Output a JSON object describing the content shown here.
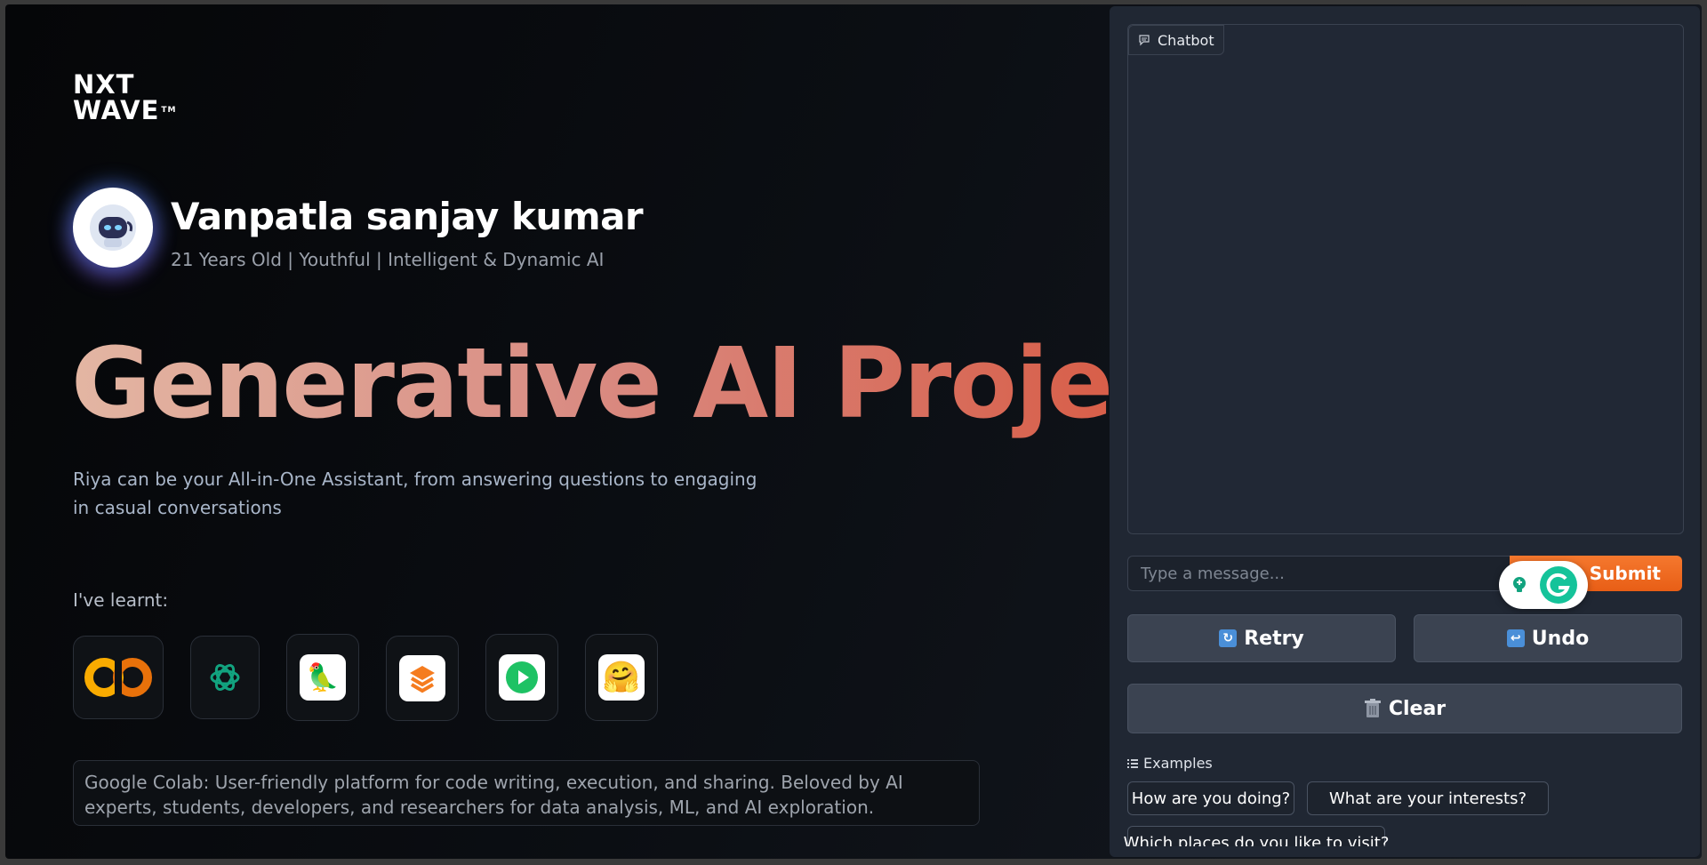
{
  "brand": {
    "logo_line1": "NXT",
    "logo_line2": "WAVE",
    "logo_tm": "TM"
  },
  "profile": {
    "name": "Vanpatla sanjay kumar",
    "subtitle": "21 Years Old | Youthful | Intelligent & Dynamic AI"
  },
  "hero": {
    "title": "Generative AI Project",
    "description": "Riya can be your All-in-One Assistant, from answering questions to engaging in casual conversations"
  },
  "learnt": {
    "label": "I've learnt:",
    "tools": [
      "colab-icon",
      "openai-icon",
      "langchain-icon",
      "stack-icon",
      "play-icon",
      "huggingface-icon"
    ],
    "description": "Google Colab: User-friendly platform for code writing, execution, and sharing. Beloved by AI experts, students, developers, and researchers for data analysis, ML, and AI exploration."
  },
  "chat": {
    "label": "Chatbot",
    "input_placeholder": "Type a message...",
    "submit_label": "Submit",
    "retry_label": "Retry",
    "undo_label": "Undo",
    "clear_label": "Clear",
    "examples_label": "Examples",
    "examples": [
      "How are you doing?",
      "What are your interests?",
      "Which places do you like to visit?"
    ]
  },
  "colors": {
    "accent_orange": "#f26a21",
    "hero_gradient_start": "#e3b6a3",
    "hero_gradient_end": "#d8563e",
    "panel_bg": "#202733"
  }
}
